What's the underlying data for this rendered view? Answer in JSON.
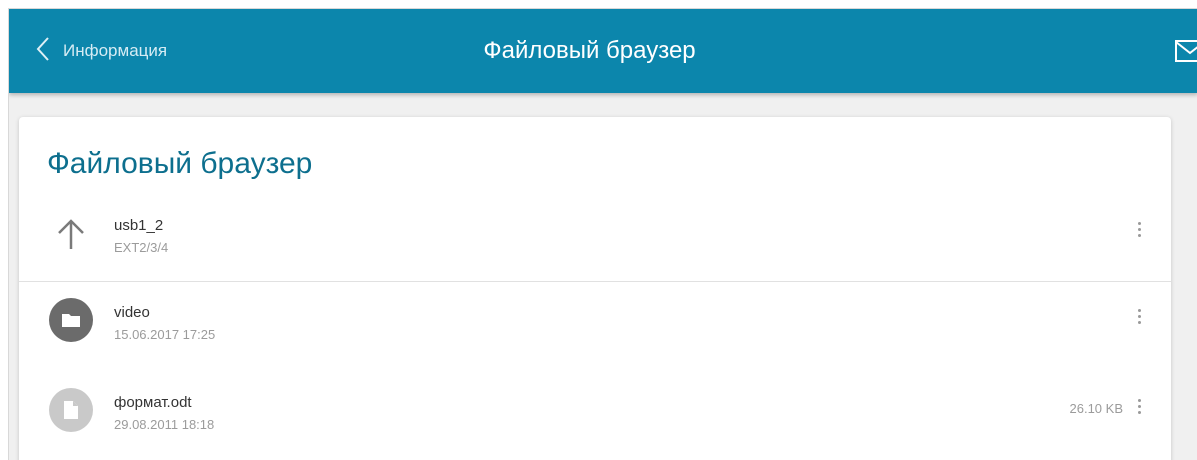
{
  "header": {
    "back_label": "Информация",
    "title": "Файловый браузер",
    "mail_icon": "mail-icon"
  },
  "colors": {
    "header_bg": "#0c86ac",
    "card_title": "#0d6f8e",
    "folder_icon_bg": "#6b6b6b",
    "file_icon_bg": "#c9c9c9"
  },
  "card": {
    "title": "Файловый браузер",
    "parent": {
      "name": "usb1_2",
      "sub": "EXT2/3/4",
      "icon": "arrow-up-icon"
    },
    "items": [
      {
        "name": "video",
        "sub": "15.06.2017 17:25",
        "size": "",
        "icon": "folder-icon"
      },
      {
        "name": "формат.odt",
        "sub": "29.08.2011 18:18",
        "size": "26.10 KB",
        "icon": "file-icon"
      }
    ]
  }
}
